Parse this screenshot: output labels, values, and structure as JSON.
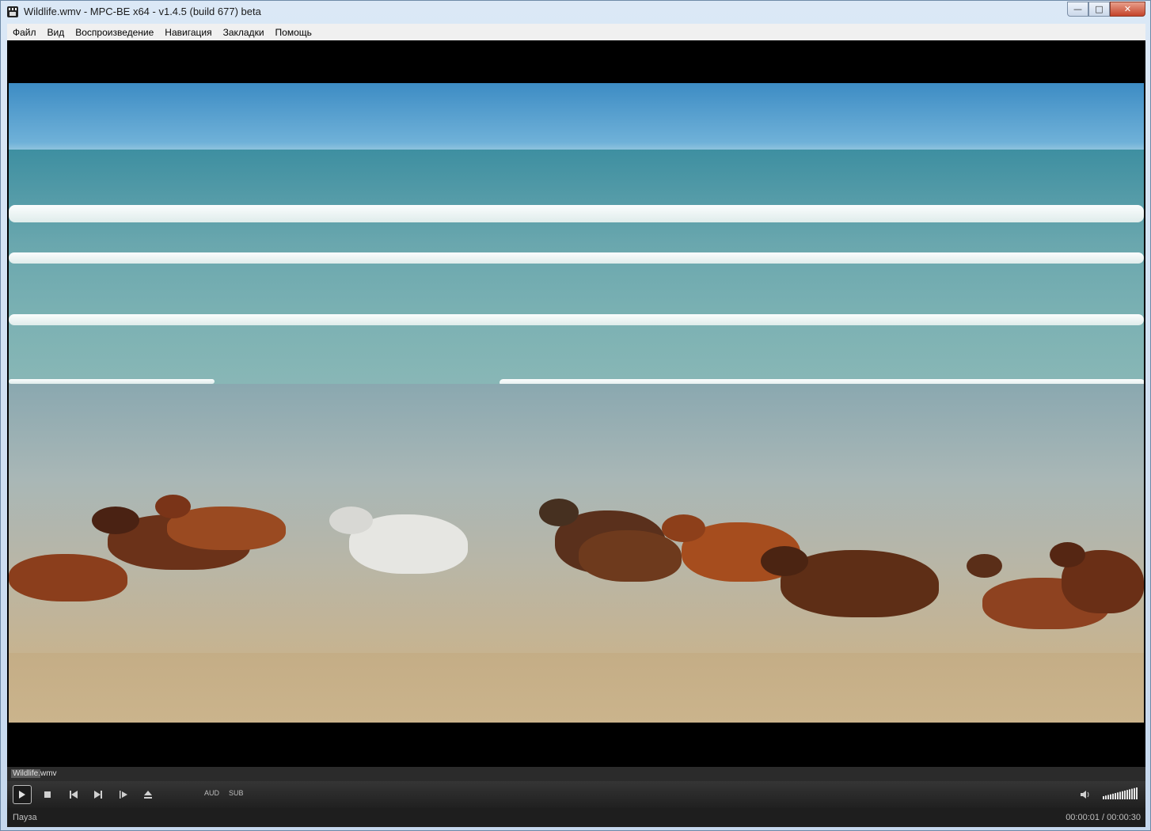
{
  "window": {
    "title": "Wildlife.wmv - MPC-BE x64 - v1.4.5 (build 677) beta",
    "controls": {
      "minimize": "—",
      "maximize": "□",
      "close": "✕"
    }
  },
  "menu": {
    "items": [
      "Файл",
      "Вид",
      "Воспроизведение",
      "Навигация",
      "Закладки",
      "Помощь"
    ]
  },
  "playlist_bar": {
    "filename": "Wildlife.wmv"
  },
  "controls": {
    "play_icon": "play-icon",
    "stop_icon": "stop-icon",
    "prev_icon": "previous-icon",
    "next_icon": "next-icon",
    "frame_step_icon": "frame-step-icon",
    "eject_icon": "eject-icon",
    "audio_label": "AUD",
    "subtitle_label": "SUB",
    "volume_icon": "speaker-icon",
    "volume_level": 1.0
  },
  "status": {
    "state": "Пауза",
    "time": "00:00:01 / 00:00:30"
  },
  "colors": {
    "titlebar": "#c6d8ee",
    "player_bg": "#202020",
    "close_button": "#c4432a"
  }
}
